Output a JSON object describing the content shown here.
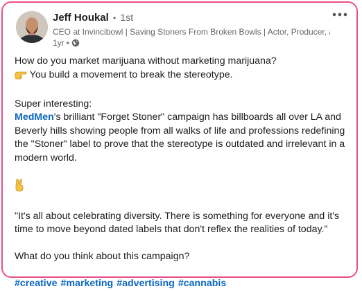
{
  "author": {
    "name": "Jeff Houkal",
    "connection_sep": "•",
    "connection": "1st",
    "headline": "CEO at Invincibowl | Saving Stoners From Broken Bowls | Actor, Producer, an...",
    "time_sep": "•",
    "time": "1yr"
  },
  "icons": {
    "avatar": "avatar-photo",
    "more": "more-horizontal-icon",
    "visibility": "globe-icon",
    "pointing": "pointing-hand-emoji",
    "peace": "peace-hand-emoji"
  },
  "post": {
    "line1": "How do you market marijuana without marketing marijuana?",
    "line2": " You build a movement to break the stereotype.",
    "line3": "Super interesting:",
    "mention": "MedMen",
    "line4_rest": "'s brilliant \"Forget Stoner\" campaign has billboards all over LA and Beverly hills showing people from all walks of life and professions redefining the \"Stoner\" label to prove that the stereotype is outdated and irrelevant in a modern world.",
    "quote": "\"It's all about celebrating diversity. There is something for everyone and it's time to move beyond dated labels that don't reflex the realities of today.\"",
    "question": "What do you think about this campaign?",
    "hashtags": [
      "#creative",
      "#marketing",
      "#advertising",
      "#cannabis"
    ]
  },
  "colors": {
    "border": "#e84f86",
    "link": "#0a66c2",
    "text": "#1d1d1d",
    "muted": "#666666"
  }
}
